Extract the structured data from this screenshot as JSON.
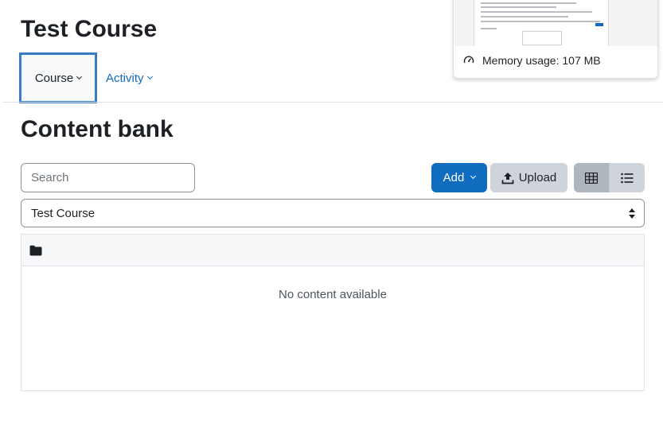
{
  "course": {
    "title": "Test Course"
  },
  "nav": {
    "items": [
      {
        "label": "Course",
        "active": true
      },
      {
        "label": "Activity",
        "active": false
      }
    ]
  },
  "perf": {
    "memory_label": "Memory usage: 107 MB",
    "icon": "gauge-icon"
  },
  "page": {
    "heading": "Content bank"
  },
  "toolbar": {
    "search_placeholder": "Search",
    "add_label": "Add",
    "upload_label": "Upload",
    "view_modes": [
      "icons-view",
      "details-view"
    ],
    "active_view": "icons-view"
  },
  "context_select": {
    "value": "Test Course"
  },
  "content": {
    "folder_icon": "folder-icon",
    "empty_text": "No content available"
  },
  "colors": {
    "primary": "#0f6cbf",
    "secondary": "#ced4da",
    "focus": "#3a7bc8",
    "text": "#1d2125"
  }
}
